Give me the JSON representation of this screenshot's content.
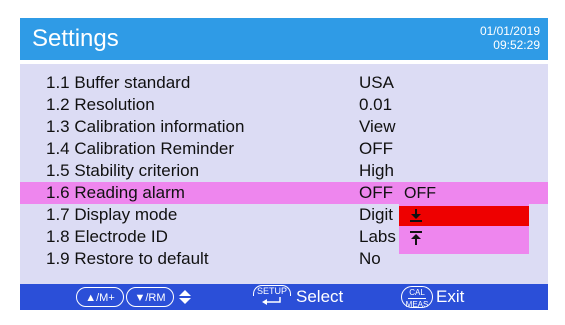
{
  "header": {
    "title": "Settings",
    "date": "01/01/2019",
    "time": "09:52:29"
  },
  "menu": {
    "items": [
      {
        "label": "1.1 Buffer standard",
        "value": "USA"
      },
      {
        "label": "1.2 Resolution",
        "value": "0.01"
      },
      {
        "label": "1.3 Calibration information",
        "value": "View"
      },
      {
        "label": "1.4 Calibration Reminder",
        "value": "OFF"
      },
      {
        "label": "1.5 Stability criterion",
        "value": "High"
      },
      {
        "label": "1.6 Reading alarm",
        "value": "OFF"
      },
      {
        "label": "1.7 Display mode",
        "value": "Digit"
      },
      {
        "label": "1.8 Electrode ID",
        "value": "Labs"
      },
      {
        "label": "1.9 Restore to default",
        "value": "No"
      }
    ],
    "highlighted_index": 5
  },
  "dropdown": {
    "options": [
      {
        "label": "OFF",
        "icon": "text"
      },
      {
        "label": "",
        "icon": "lower-limit-icon"
      },
      {
        "label": "",
        "icon": "upper-limit-icon"
      }
    ],
    "selected_index": 1
  },
  "footer": {
    "up_key": "▲/M+",
    "down_key": "▼/RM",
    "setup_key": "SETUP",
    "select_label": "Select",
    "cal_key_top": "CAL",
    "cal_key_bottom": "MEAS",
    "exit_label": "Exit"
  },
  "colors": {
    "header": "#2f9be6",
    "background": "#dcdcf4",
    "highlight": "#ee86ee",
    "selected": "#ee0000",
    "footer": "#2b4fd8"
  }
}
